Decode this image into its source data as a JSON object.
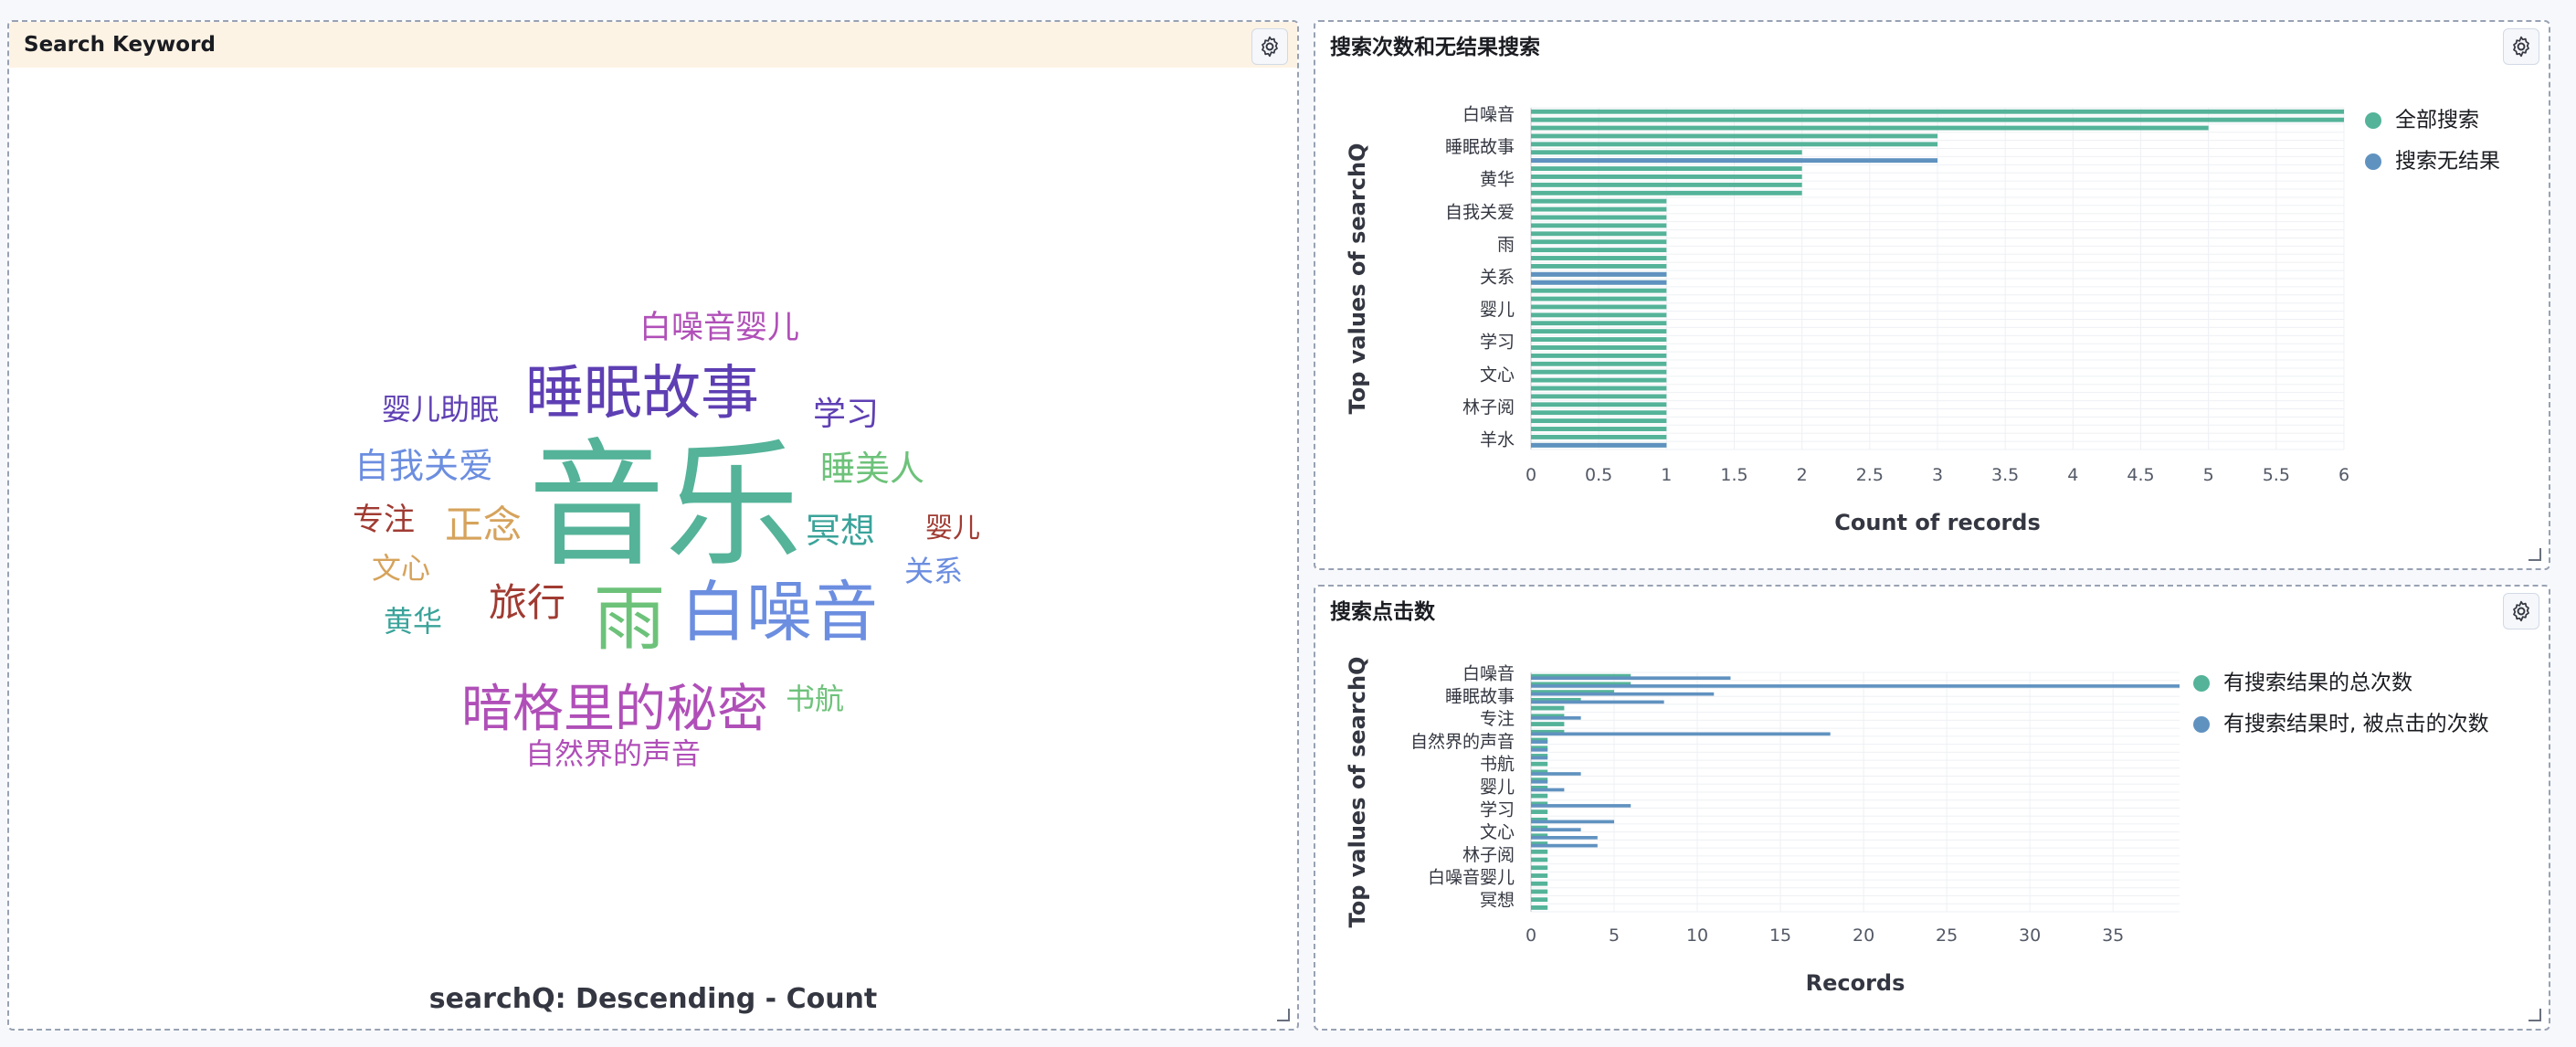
{
  "left_panel": {
    "title": "Search Keyword",
    "caption": "searchQ: Descending - Count",
    "words": [
      {
        "text": "音乐",
        "color": "#54b399"
      },
      {
        "text": "睡眠故事",
        "color": "#5e3fb3"
      },
      {
        "text": "白噪音",
        "color": "#6c8ee0"
      },
      {
        "text": "雨",
        "color": "#6dc27a"
      },
      {
        "text": "暗格里的秘密",
        "color": "#b04fb8"
      },
      {
        "text": "白噪音婴儿",
        "color": "#b04fb8"
      },
      {
        "text": "婴儿助眠",
        "color": "#5e3fb3"
      },
      {
        "text": "学习",
        "color": "#5e3fb3"
      },
      {
        "text": "自我关爱",
        "color": "#6c8ee0"
      },
      {
        "text": "睡美人",
        "color": "#6dc27a"
      },
      {
        "text": "专注",
        "color": "#a03b32"
      },
      {
        "text": "正念",
        "color": "#d6a35c"
      },
      {
        "text": "冥想",
        "color": "#3aa39a"
      },
      {
        "text": "婴儿",
        "color": "#a03b32"
      },
      {
        "text": "文心",
        "color": "#d6a35c"
      },
      {
        "text": "关系",
        "color": "#6c8ee0"
      },
      {
        "text": "旅行",
        "color": "#a03b32"
      },
      {
        "text": "黄华",
        "color": "#3aa39a"
      },
      {
        "text": "书航",
        "color": "#6dc27a"
      },
      {
        "text": "自然界的声音",
        "color": "#b04fb8"
      }
    ]
  },
  "top_right_panel": {
    "title": "搜索次数和无结果搜索",
    "chart_data": {
      "type": "bar",
      "orientation": "horizontal",
      "categories": [
        "白噪音",
        "睡眠故事",
        "黄华",
        "自我关爱",
        "雨",
        "关系",
        "婴儿",
        "学习",
        "文心",
        "林子阅",
        "羊水"
      ],
      "series": [
        {
          "name": "全部搜索",
          "color": "#54b399",
          "values": [
            6,
            6,
            5,
            3,
            3,
            2,
            2,
            2,
            2,
            2,
            2,
            1,
            1,
            1,
            1,
            1,
            1,
            1,
            1,
            1,
            1,
            1,
            1,
            1,
            1,
            1,
            1,
            1,
            1,
            1,
            1,
            1,
            1,
            1,
            1,
            1,
            1,
            1,
            1,
            1,
            1,
            1
          ]
        },
        {
          "name": "搜索无结果",
          "color": "#6092c0",
          "indices": [
            6,
            20,
            21,
            41
          ],
          "values": [
            3,
            1,
            1,
            1
          ]
        }
      ],
      "xlabel": "Count of records",
      "ylabel": "Top values of searchQ",
      "xlim": [
        0,
        6
      ],
      "xticks": [
        "0",
        "0.5",
        "1",
        "1.5",
        "2",
        "2.5",
        "3",
        "3.5",
        "4",
        "4.5",
        "5",
        "5.5",
        "6"
      ],
      "legend": "right"
    }
  },
  "bottom_right_panel": {
    "title": "搜索点击数",
    "chart_data": {
      "type": "bar",
      "orientation": "horizontal",
      "categories": [
        "白噪音",
        "睡眠故事",
        "专注",
        "自然界的声音",
        "书航",
        "婴儿",
        "学习",
        "文心",
        "林子阅",
        "白噪音婴儿",
        "冥想"
      ],
      "series": [
        {
          "name": "有搜索结果的总次数",
          "color": "#54b399",
          "values": [
            6,
            6,
            5,
            3,
            2,
            2,
            2,
            2,
            1,
            1,
            1,
            1,
            1,
            1,
            1,
            1,
            1,
            1,
            1,
            1,
            1,
            1,
            1,
            1,
            1,
            1,
            1,
            1,
            1,
            1
          ]
        },
        {
          "name": "有搜索结果时, 被点击的次数",
          "color": "#6092c0",
          "values": [
            12,
            39,
            11,
            8,
            0,
            3,
            0,
            18,
            1,
            1,
            1,
            0,
            3,
            1,
            2,
            0,
            6,
            0,
            5,
            3,
            4,
            4
          ]
        }
      ],
      "xlabel": "Records",
      "ylabel": "Top values of searchQ",
      "xlim": [
        0,
        39
      ],
      "xticks": [
        "0",
        "5",
        "10",
        "15",
        "20",
        "25",
        "30",
        "35"
      ],
      "legend": "right"
    }
  }
}
